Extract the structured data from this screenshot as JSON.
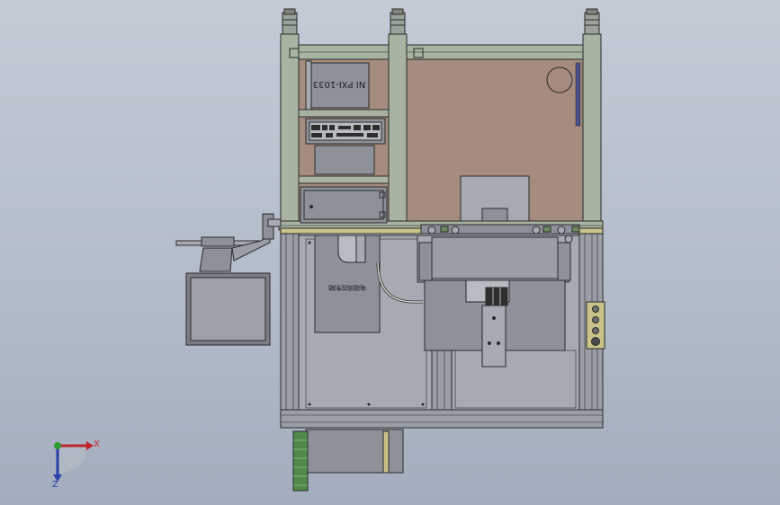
{
  "viewport": {
    "background_top": "#c4cbd7",
    "background_bottom": "#a3adbd"
  },
  "colors": {
    "frame_green": "#a8b3a2",
    "frame_green_dark": "#5f6b5c",
    "panel_tan": "#a68c7e",
    "metal_gray": "#8e9199",
    "metal_light": "#a7aab2",
    "extrusion": "#9a9ea6",
    "outline": "#2a2a2a",
    "rail_yellow": "#c9c38a",
    "cable_green": "#4f8a4a",
    "cable_green_light": "#7cb56f",
    "monitor_bezel": "#7b7e85",
    "monitor_screen": "#9ea1a8",
    "axis_x": "#c0242a",
    "axis_y": "#2f9a32",
    "axis_z": "#2a3fa8"
  },
  "equipment": {
    "pxi_chassis_label": "NI PXI-1033",
    "module_label": "电磁阀控制箱"
  },
  "triad": {
    "x_label": "X",
    "z_label": "Z"
  }
}
